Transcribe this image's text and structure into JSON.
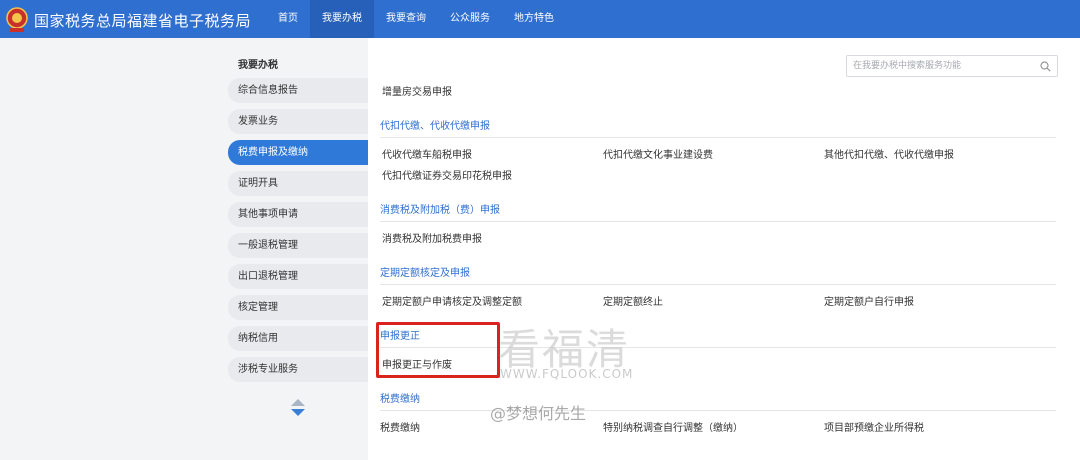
{
  "header": {
    "site_title": "国家税务总局福建省电子税务局",
    "nav": [
      "首页",
      "我要办税",
      "我要查询",
      "公众服务",
      "地方特色"
    ],
    "active_nav": 1
  },
  "sidebar": {
    "title": "我要办税",
    "items": [
      "综合信息报告",
      "发票业务",
      "税费申报及缴纳",
      "证明开具",
      "其他事项申请",
      "一般退税管理",
      "出口退税管理",
      "核定管理",
      "纳税信用",
      "涉税专业服务"
    ],
    "active_index": 2
  },
  "search": {
    "placeholder": "在我要办税中搜索服务功能"
  },
  "content": {
    "cut_item": "增量房交易申报",
    "sections": [
      {
        "title": "代扣代缴、代收代缴申报",
        "items": [
          "代收代缴车船税申报",
          "代扣代缴文化事业建设费",
          "其他代扣代缴、代收代缴申报",
          "代扣代缴证券交易印花税申报"
        ]
      },
      {
        "title": "消费税及附加税（费）申报",
        "items": [
          "消费税及附加税费申报"
        ]
      },
      {
        "title": "定期定额核定及申报",
        "items": [
          "定期定额户申请核定及调整定额",
          "定期定额终止",
          "定期定额户自行申报"
        ]
      },
      {
        "title": "申报更正",
        "items": [
          "申报更正与作废"
        ]
      },
      {
        "title": "税费缴纳",
        "items": [
          "税费缴纳",
          "特别纳税调查自行调整（缴纳）",
          "项目部预缴企业所得税"
        ]
      }
    ]
  },
  "watermark": {
    "big": "看福清",
    "url": "WWW.FQLOOK.COM",
    "author": "@梦想何先生"
  },
  "colors": {
    "header": "#2f6fd0",
    "active_side": "#2f7ad8",
    "section_title": "#2f6fd0",
    "highlight": "#d8241d"
  }
}
